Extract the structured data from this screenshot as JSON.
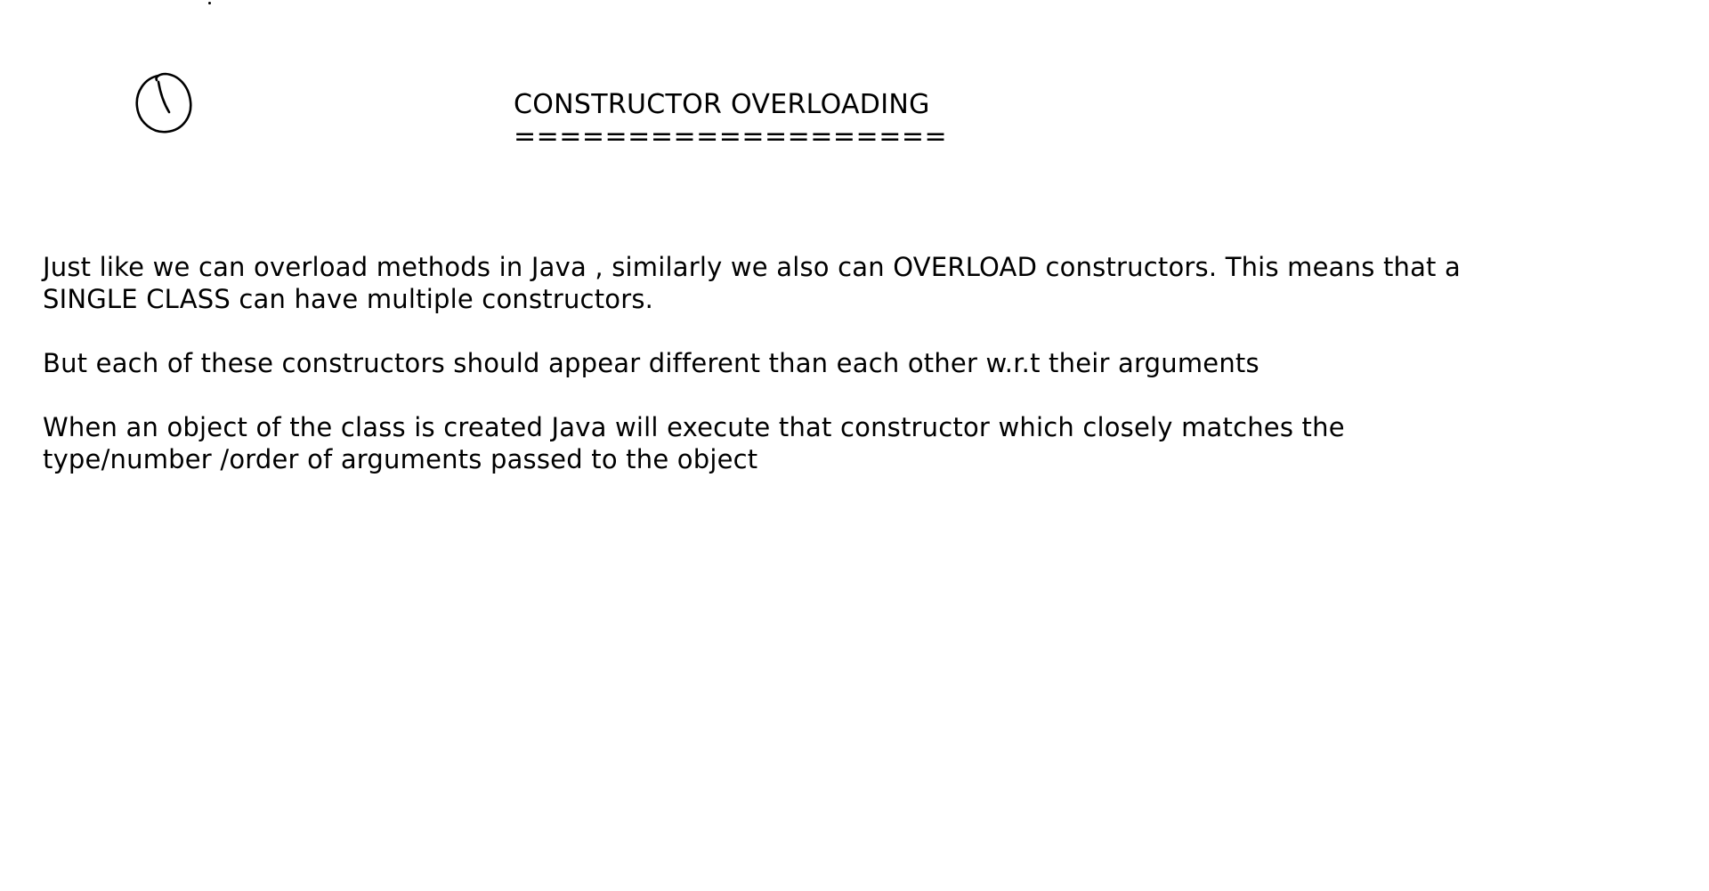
{
  "document": {
    "title": "CONSTRUCTOR OVERLOADING",
    "title_underline": "===================",
    "paragraphs": [
      {
        "lines": [
          "Just like we can overload methods in Java , similarly we also can OVERLOAD constructors. This means that a",
          "SINGLE CLASS can have multiple constructors."
        ]
      },
      {
        "lines": [
          "But each of these constructors should appear different than each other w.r.t their arguments"
        ]
      },
      {
        "lines": [
          "When an object of the class is created Java will execute that constructor which closely matches the",
          "type/number /order of arguments passed to the object"
        ]
      }
    ]
  },
  "annotations": {
    "sketch_icon": "hand-drawn-circled-one-icon",
    "ink_color": "#000000",
    "background_color": "#ffffff"
  }
}
